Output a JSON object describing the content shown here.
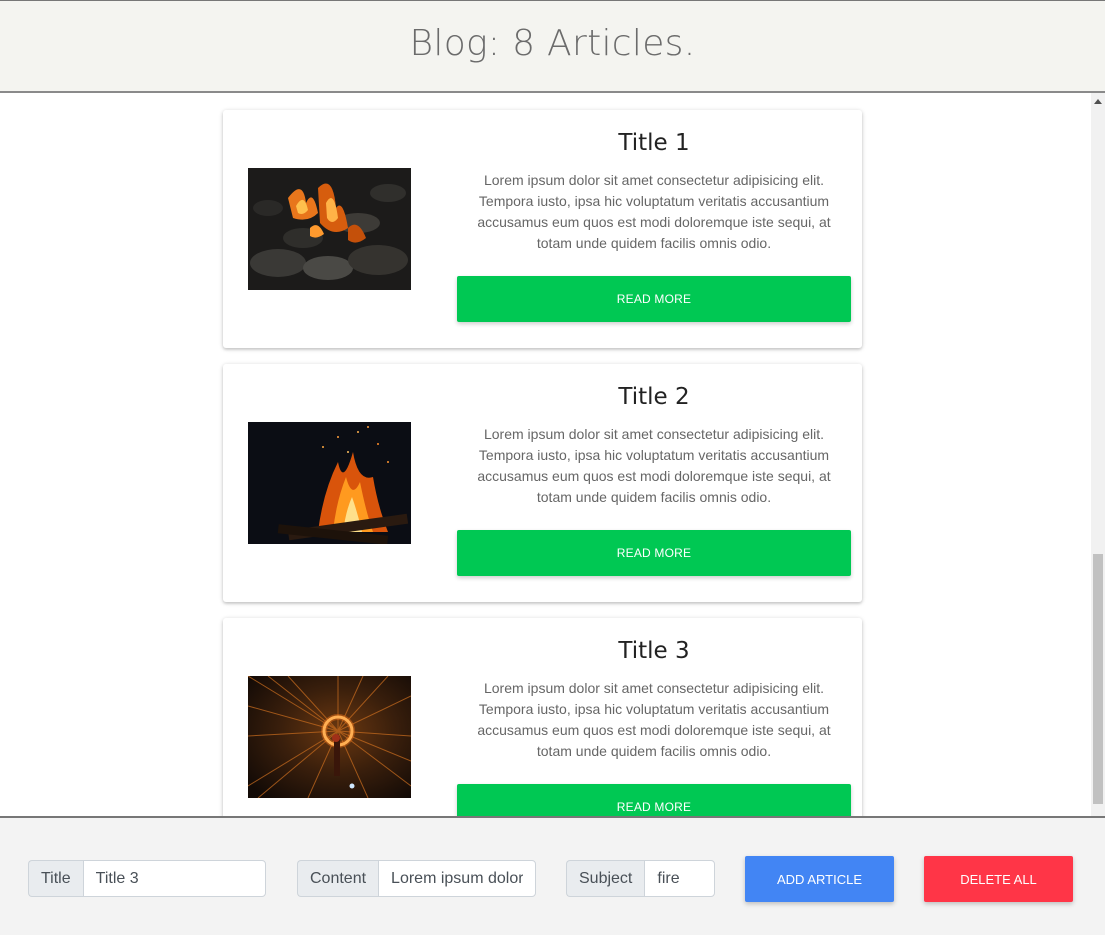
{
  "header": {
    "title": "Blog: 8 Articles."
  },
  "articles": [
    {
      "title": "Title 1",
      "text": "Lorem ipsum dolor sit amet consectetur adipisicing elit. Tempora iusto, ipsa hic voluptatum veritatis accusantium accusamus eum quos est modi doloremque iste sequi, at totam unde quidem facilis omnis odio.",
      "button_label": "READ MORE"
    },
    {
      "title": "Title 2",
      "text": "Lorem ipsum dolor sit amet consectetur adipisicing elit. Tempora iusto, ipsa hic voluptatum veritatis accusantium accusamus eum quos est modi doloremque iste sequi, at totam unde quidem facilis omnis odio.",
      "button_label": "READ MORE"
    },
    {
      "title": "Title 3",
      "text": "Lorem ipsum dolor sit amet consectetur adipisicing elit. Tempora iusto, ipsa hic voluptatum veritatis accusantium accusamus eum quos est modi doloremque iste sequi, at totam unde quidem facilis omnis odio.",
      "button_label": "READ MORE"
    }
  ],
  "form": {
    "title_label": "Title",
    "title_value": "Title 3",
    "content_label": "Content",
    "content_value": "Lorem ipsum dolor",
    "subject_label": "Subject",
    "subject_value": "fire",
    "add_label": "ADD ARTICLE",
    "delete_label": "DELETE ALL"
  },
  "colors": {
    "read_more": "#00c853",
    "add_article": "#4285f4",
    "delete_all": "#ff3547"
  }
}
